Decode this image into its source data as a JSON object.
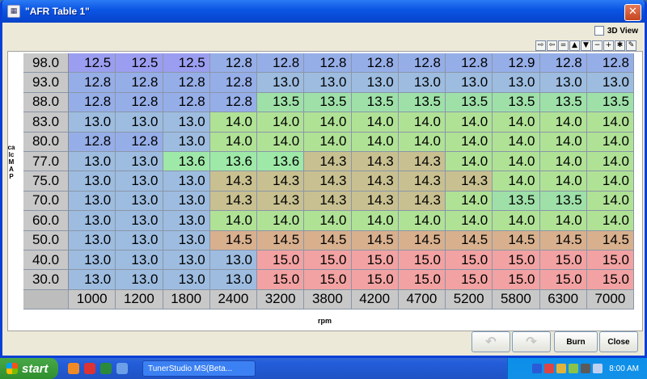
{
  "window": {
    "title": "\"AFR Table 1\"",
    "close_symbol": "✕"
  },
  "view3d_label": "3D View",
  "tools": [
    "⇨",
    "⇦",
    "=",
    "▲",
    "▼",
    "−",
    "+",
    "✱",
    "✎"
  ],
  "y_axis_label": "calcMAP",
  "x_axis_label": "rpm",
  "table": {
    "rows": [
      "98.0",
      "93.0",
      "88.0",
      "83.0",
      "80.0",
      "77.0",
      "75.0",
      "70.0",
      "60.0",
      "50.0",
      "40.0",
      "30.0"
    ],
    "cols": [
      "1000",
      "1200",
      "1800",
      "2400",
      "3200",
      "3800",
      "4200",
      "4700",
      "5200",
      "5800",
      "6300",
      "7000"
    ],
    "values": [
      [
        "12.5",
        "12.5",
        "12.5",
        "12.8",
        "12.8",
        "12.8",
        "12.8",
        "12.8",
        "12.8",
        "12.9",
        "12.8",
        "12.8"
      ],
      [
        "12.8",
        "12.8",
        "12.8",
        "12.8",
        "13.0",
        "13.0",
        "13.0",
        "13.0",
        "13.0",
        "13.0",
        "13.0",
        "13.0"
      ],
      [
        "12.8",
        "12.8",
        "12.8",
        "12.8",
        "13.5",
        "13.5",
        "13.5",
        "13.5",
        "13.5",
        "13.5",
        "13.5",
        "13.5"
      ],
      [
        "13.0",
        "13.0",
        "13.0",
        "14.0",
        "14.0",
        "14.0",
        "14.0",
        "14.0",
        "14.0",
        "14.0",
        "14.0",
        "14.0"
      ],
      [
        "12.8",
        "12.8",
        "13.0",
        "14.0",
        "14.0",
        "14.0",
        "14.0",
        "14.0",
        "14.0",
        "14.0",
        "14.0",
        "14.0"
      ],
      [
        "13.0",
        "13.0",
        "13.6",
        "13.6",
        "13.6",
        "14.3",
        "14.3",
        "14.3",
        "14.0",
        "14.0",
        "14.0",
        "14.0"
      ],
      [
        "13.0",
        "13.0",
        "13.0",
        "14.3",
        "14.3",
        "14.3",
        "14.3",
        "14.3",
        "14.3",
        "14.0",
        "14.0",
        "14.0"
      ],
      [
        "13.0",
        "13.0",
        "13.0",
        "14.3",
        "14.3",
        "14.3",
        "14.3",
        "14.3",
        "14.0",
        "13.5",
        "13.5",
        "14.0"
      ],
      [
        "13.0",
        "13.0",
        "13.0",
        "14.0",
        "14.0",
        "14.0",
        "14.0",
        "14.0",
        "14.0",
        "14.0",
        "14.0",
        "14.0"
      ],
      [
        "13.0",
        "13.0",
        "13.0",
        "14.5",
        "14.5",
        "14.5",
        "14.5",
        "14.5",
        "14.5",
        "14.5",
        "14.5",
        "14.5"
      ],
      [
        "13.0",
        "13.0",
        "13.0",
        "13.0",
        "15.0",
        "15.0",
        "15.0",
        "15.0",
        "15.0",
        "15.0",
        "15.0",
        "15.0"
      ],
      [
        "13.0",
        "13.0",
        "13.0",
        "13.0",
        "15.0",
        "15.0",
        "15.0",
        "15.0",
        "15.0",
        "15.0",
        "15.0",
        "15.0"
      ]
    ],
    "color_scale": {
      "12.5": "#9b9ef0",
      "12.8": "#96aee8",
      "12.9": "#96aee8",
      "13.0": "#9dbce0",
      "13.5": "#9ee0a8",
      "13.6": "#9ee8a8",
      "14.0": "#b0e296",
      "14.3": "#c8c090",
      "14.5": "#d8b08e",
      "15.0": "#f2a2a2"
    }
  },
  "buttons": {
    "undo_symbol": "↶",
    "redo_symbol": "↷",
    "burn": "Burn",
    "close": "Close"
  },
  "taskbar": {
    "start": "start",
    "task": "TunerStudio MS(Beta...",
    "clock": "8:00 AM"
  }
}
